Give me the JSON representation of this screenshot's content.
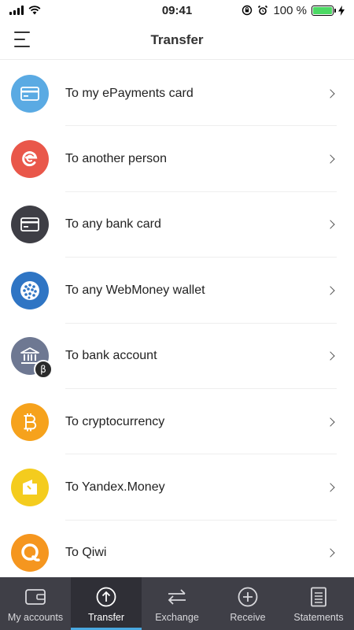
{
  "status_bar": {
    "time": "09:41",
    "battery": "100 %",
    "battery_level": 1.0
  },
  "header": {
    "title": "Transfer",
    "menu_icon": "hamburger-icon"
  },
  "transfer_options": [
    {
      "label": "To my ePayments card",
      "icon": "card-icon",
      "color": "#5aaae3"
    },
    {
      "label": "To another person",
      "icon": "epayments-logo-icon",
      "color": "#e9574a"
    },
    {
      "label": "To any bank card",
      "icon": "card-icon",
      "color": "#3e3e45"
    },
    {
      "label": "To any WebMoney wallet",
      "icon": "webmoney-globe-icon",
      "color": "#2f75c4"
    },
    {
      "label": "To bank account",
      "icon": "bank-icon",
      "color": "#6e7892",
      "badge": "β"
    },
    {
      "label": "To cryptocurrency",
      "icon": "bitcoin-icon",
      "color": "#f6a21c"
    },
    {
      "label": "To Yandex.Money",
      "icon": "yandex-money-icon",
      "color": "#f4cc1e"
    },
    {
      "label": "To Qiwi",
      "icon": "qiwi-icon",
      "color": "#f5961f"
    }
  ],
  "tabs": [
    {
      "label": "My accounts",
      "icon": "wallet-icon",
      "active": false
    },
    {
      "label": "Transfer",
      "icon": "arrow-up-circle-icon",
      "active": true
    },
    {
      "label": "Exchange",
      "icon": "exchange-arrows-icon",
      "active": false
    },
    {
      "label": "Receive",
      "icon": "plus-circle-icon",
      "active": false
    },
    {
      "label": "Statements",
      "icon": "document-icon",
      "active": false
    }
  ],
  "colors": {
    "tab_bar": "#3f3f47",
    "tab_active": "#2f2f36",
    "accent": "#4aa8e0"
  }
}
